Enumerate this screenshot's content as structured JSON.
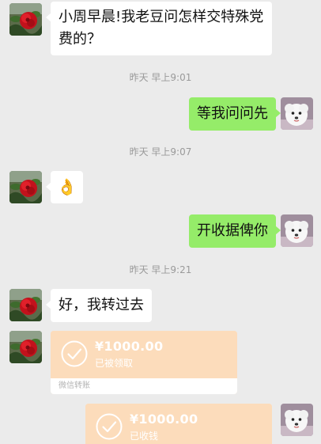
{
  "messages": {
    "m1": {
      "text": "小周早晨!我老豆问怎样交特殊党费的？"
    },
    "t1": {
      "time": "昨天 早上9:01"
    },
    "m2": {
      "text": "等我问问先"
    },
    "t2": {
      "time": "昨天 早上9:07"
    },
    "m3": {
      "emoji": "👌"
    },
    "m4": {
      "text": "开收据俾你"
    },
    "t3": {
      "time": "昨天 早上9:21"
    },
    "m5": {
      "text": "好，我转过去"
    },
    "transfer_in": {
      "amount": "¥1000.00",
      "status": "已被领取",
      "footer": "微信转账"
    },
    "transfer_out": {
      "amount": "¥1000.00",
      "status": "已收钱"
    }
  },
  "colors": {
    "background": "#ebebeb",
    "outgoing_bubble": "#95ec69",
    "incoming_bubble": "#ffffff",
    "transfer": "#fcdcbb"
  },
  "avatars": {
    "left": "red-flower-icon",
    "right": "white-dog-icon"
  }
}
